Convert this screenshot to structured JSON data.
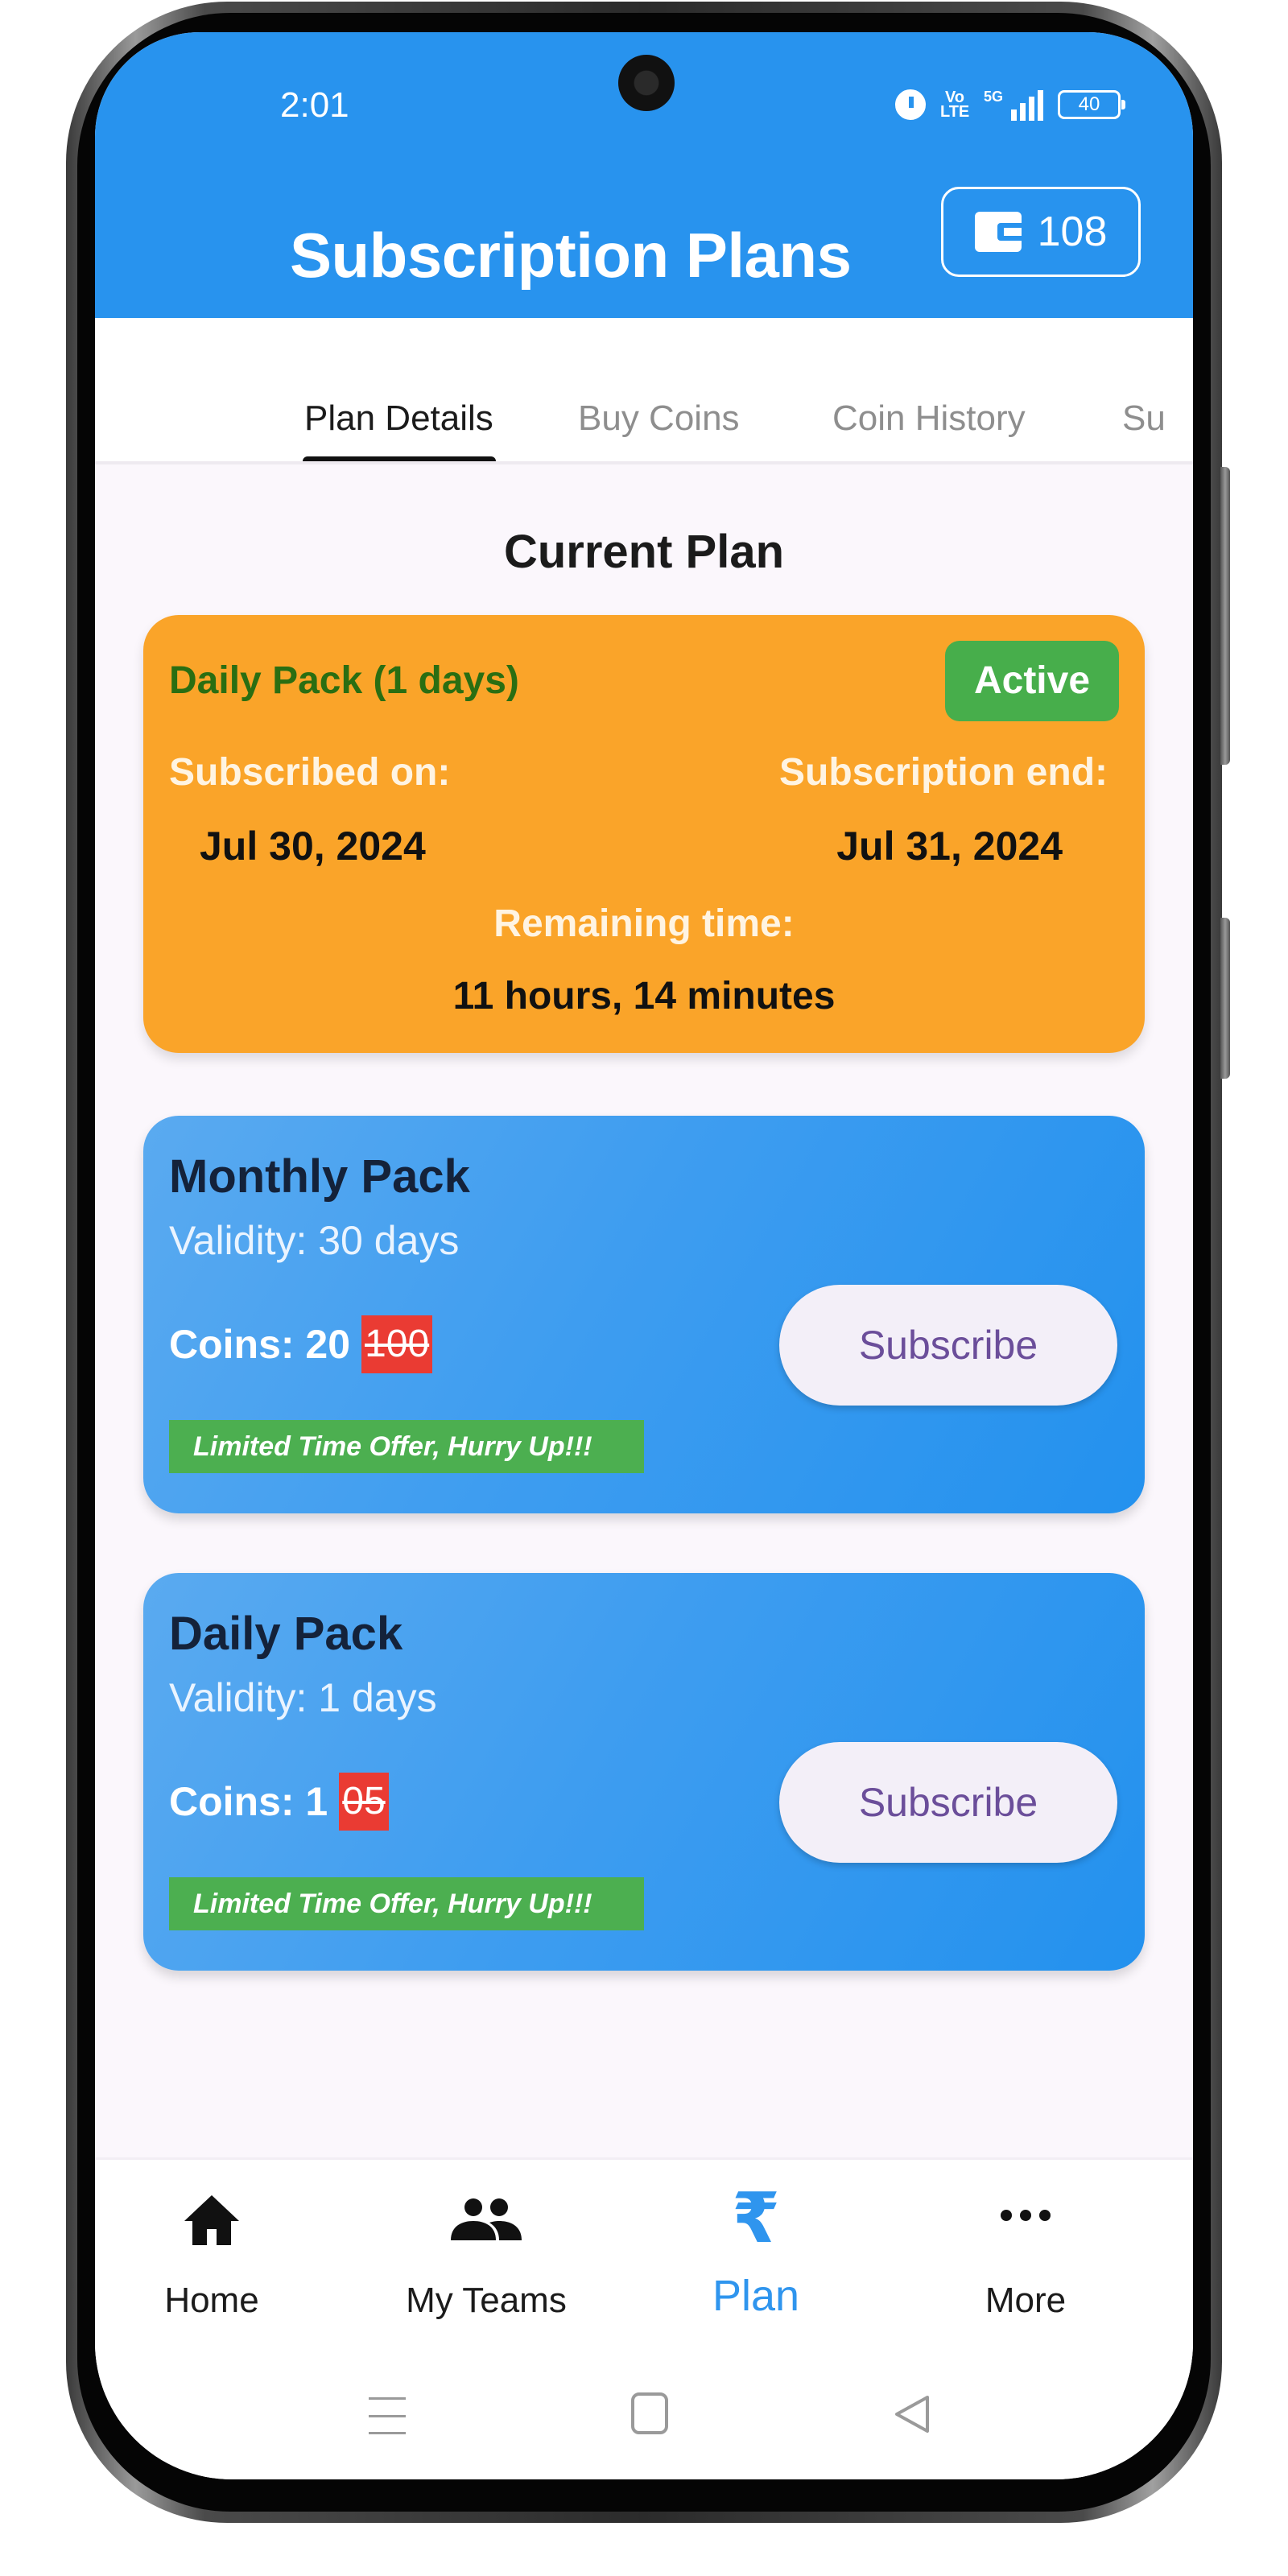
{
  "status_bar": {
    "time": "2:01",
    "volte": "Vo LTE",
    "network": "5G",
    "battery": "40"
  },
  "app_bar": {
    "title": "Subscription Plans",
    "coin_balance": "108"
  },
  "tabs": [
    {
      "label": "Plan Details",
      "active": true
    },
    {
      "label": "Buy Coins",
      "active": false
    },
    {
      "label": "Coin History",
      "active": false
    },
    {
      "label": "Su",
      "active": false
    }
  ],
  "current_plan": {
    "section_title": "Current Plan",
    "name": "Daily Pack (1 days)",
    "status": "Active",
    "subscribed_label": "Subscribed on:",
    "subscribed_date": "Jul 30, 2024",
    "end_label": "Subscription end:",
    "end_date": "Jul 31, 2024",
    "remaining_label": "Remaining time:",
    "remaining_value": "11 hours, 14 minutes"
  },
  "plans": [
    {
      "name": "Monthly Pack",
      "validity": "Validity: 30 days",
      "coins_label": "Coins: 20",
      "old_price": "100",
      "offer": "Limited Time Offer, Hurry Up!!!",
      "button": "Subscribe"
    },
    {
      "name": "Daily Pack",
      "validity": "Validity: 1 days",
      "coins_label": "Coins: 1",
      "old_price": "05",
      "offer": "Limited Time Offer, Hurry Up!!!",
      "button": "Subscribe"
    }
  ],
  "bottom_nav": [
    {
      "label": "Home",
      "icon": "home-icon",
      "active": false
    },
    {
      "label": "My Teams",
      "icon": "teams-icon",
      "active": false
    },
    {
      "label": "Plan",
      "icon": "rupee-icon",
      "active": true
    },
    {
      "label": "More",
      "icon": "more-icon",
      "active": false
    }
  ],
  "colors": {
    "primary": "#2893ee",
    "current_plan_card": "#faa429",
    "active_badge": "#47ae4b",
    "offer_badge": "#4caf50",
    "old_price_bg": "#ea3b33",
    "subscribe_text": "#6b4e9a"
  }
}
